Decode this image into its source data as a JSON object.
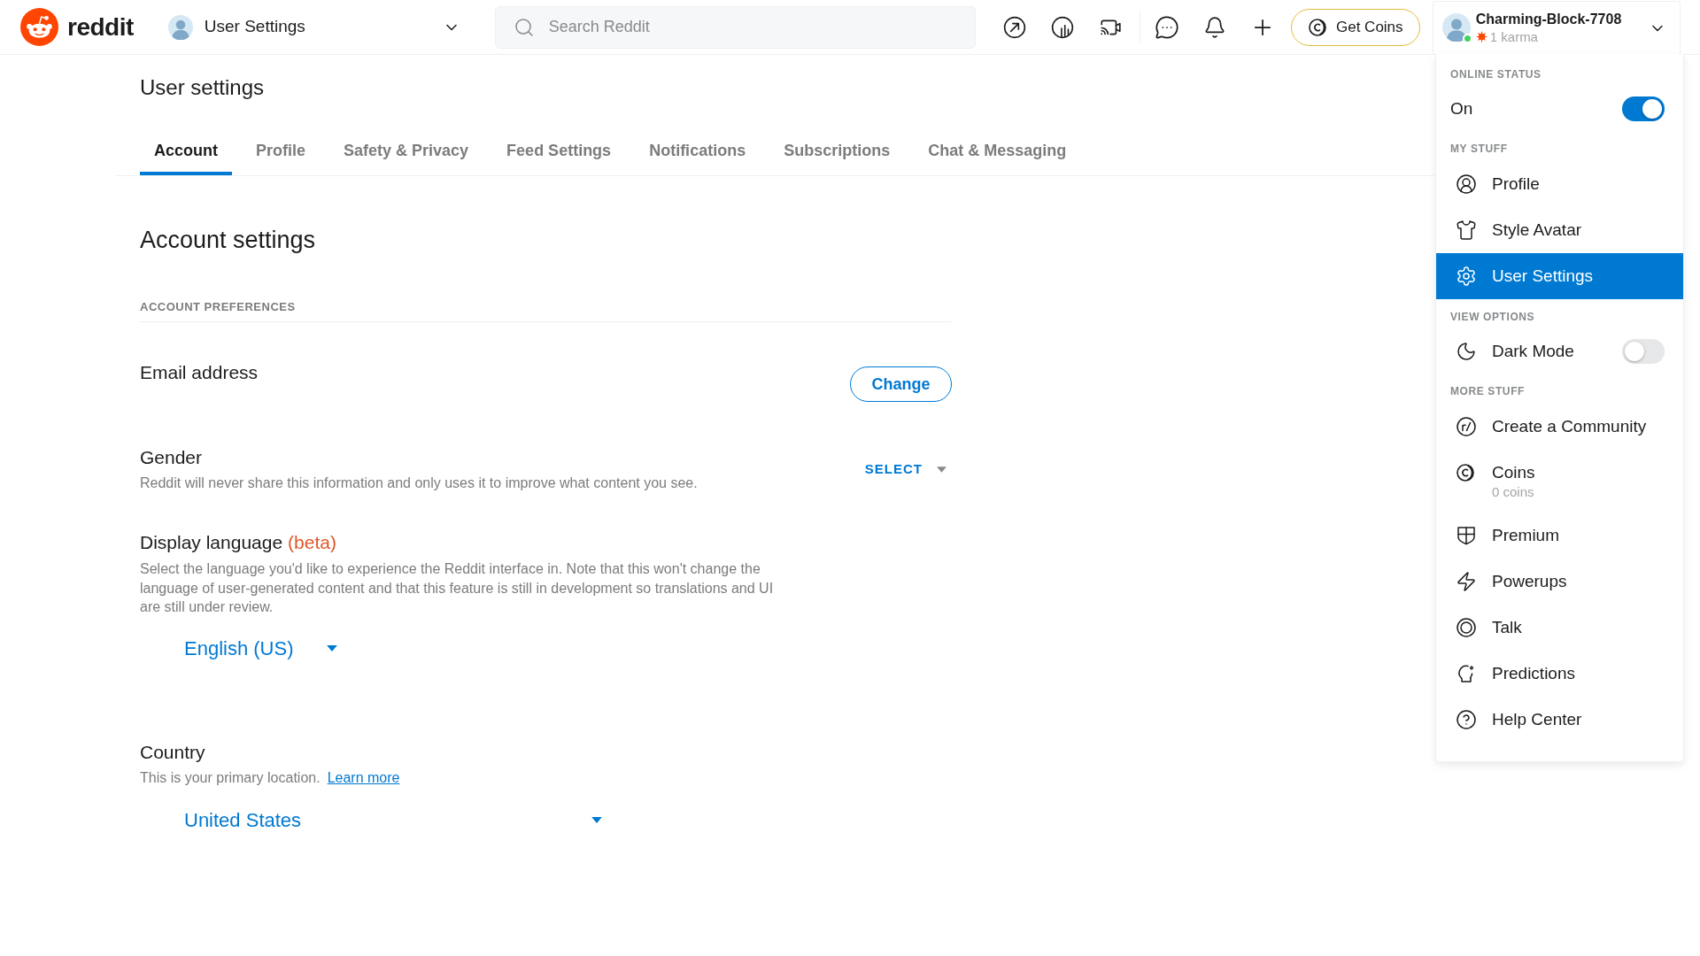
{
  "header": {
    "logo": "reddit",
    "community": "User Settings",
    "search": {
      "placeholder": "Search Reddit"
    },
    "coins_button": "Get Coins",
    "user": {
      "name": "Charming-Block-7708",
      "karma": "1 karma",
      "online": true
    }
  },
  "page": {
    "title": "User settings",
    "tabs": [
      {
        "label": "Account",
        "selected": true
      },
      {
        "label": "Profile",
        "selected": false
      },
      {
        "label": "Safety & Privacy",
        "selected": false
      },
      {
        "label": "Feed Settings",
        "selected": false
      },
      {
        "label": "Notifications",
        "selected": false
      },
      {
        "label": "Subscriptions",
        "selected": false
      },
      {
        "label": "Chat & Messaging",
        "selected": false
      }
    ]
  },
  "account": {
    "title": "Account settings",
    "section": "ACCOUNT PREFERENCES",
    "email": {
      "label": "Email address",
      "button": "Change"
    },
    "gender": {
      "label": "Gender",
      "description": "Reddit will never share this information and only uses it to improve what content you see.",
      "select": "SELECT"
    },
    "language": {
      "label": "Display language",
      "badge": "(beta)",
      "description": "Select the language you'd like to experience the Reddit interface in. Note that this won't change the language of user-generated content and that this feature is still in development so translations and UI are still under review.",
      "value": "English (US)"
    },
    "country": {
      "label": "Country",
      "description": "This is your primary location.",
      "link": "Learn more",
      "value": "United States"
    }
  },
  "menu": {
    "sections": [
      {
        "title": "ONLINE STATUS",
        "items": [
          {
            "kind": "toggle",
            "label": "On",
            "on": true
          }
        ]
      },
      {
        "title": "MY STUFF",
        "items": [
          {
            "kind": "link",
            "label": "Profile",
            "selected": false
          },
          {
            "kind": "link",
            "label": "Style Avatar",
            "selected": false
          },
          {
            "kind": "link",
            "label": "User Settings",
            "selected": true
          }
        ]
      },
      {
        "title": "VIEW OPTIONS",
        "items": [
          {
            "kind": "toggle",
            "label": "Dark Mode",
            "on": false
          }
        ]
      },
      {
        "title": "MORE STUFF",
        "items": [
          {
            "kind": "link",
            "label": "Create a Community",
            "selected": false
          },
          {
            "kind": "link",
            "label": "Coins",
            "detail": "0 coins",
            "selected": false
          },
          {
            "kind": "link",
            "label": "Premium",
            "selected": false
          },
          {
            "kind": "link",
            "label": "Powerups",
            "selected": false
          },
          {
            "kind": "link",
            "label": "Talk",
            "selected": false
          },
          {
            "kind": "link",
            "label": "Predictions",
            "selected": false
          },
          {
            "kind": "link",
            "label": "Help Center",
            "selected": false
          }
        ]
      }
    ]
  }
}
